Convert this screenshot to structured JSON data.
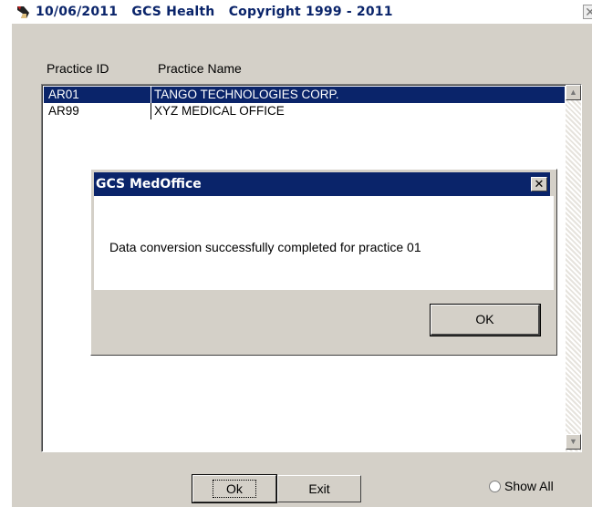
{
  "window": {
    "title": "10/06/2011   GCS Health   Copyright 1999 - 2011",
    "close_glyph": "✕",
    "icon": "app-logo-icon"
  },
  "list": {
    "headers": {
      "id": "Practice ID",
      "name": "Practice Name"
    },
    "rows": [
      {
        "id": "AR01",
        "name": "TANGO TECHNOLOGIES CORP.",
        "selected": true
      },
      {
        "id": "AR99",
        "name": "XYZ MEDICAL OFFICE",
        "selected": false
      }
    ],
    "scroll_up_glyph": "▲",
    "scroll_down_glyph": "▼"
  },
  "dialog": {
    "title": "GCS MedOffice",
    "close_glyph": "✕",
    "message": "Data conversion successfully completed for practice 01",
    "ok_label": "OK"
  },
  "footer": {
    "ok_label": "Ok",
    "exit_label": "Exit",
    "show_all_label": "Show All"
  },
  "colors": {
    "selection": "#0a246a",
    "window_bg": "#d4d0c8"
  }
}
